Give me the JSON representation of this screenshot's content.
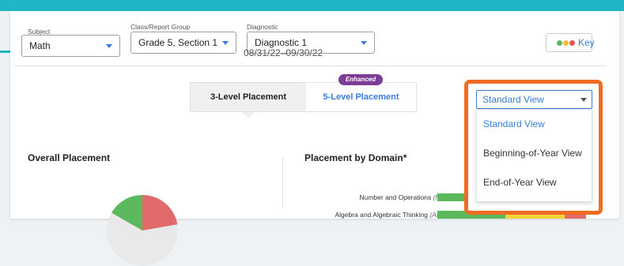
{
  "filters": {
    "subject": {
      "label": "Subject",
      "value": "Math"
    },
    "group": {
      "label": "Class/Report Group",
      "value": "Grade 5, Section 1"
    },
    "diagnostic": {
      "label": "Diagnostic",
      "value": "Diagnostic 1",
      "dates": "08/31/22–09/30/22"
    }
  },
  "key_button": {
    "label": "Key",
    "dot_colors": [
      "#5cb85c",
      "#f2c12e",
      "#e25555"
    ]
  },
  "placement_tabs": {
    "three_level": "3-Level Placement",
    "five_level": "5-Level Placement",
    "badge": "Enhanced"
  },
  "view_select": {
    "value": "Standard View",
    "options": [
      "Standard View",
      "Beginning-of-Year View",
      "End-of-Year View"
    ]
  },
  "overall_title": "Overall Placement",
  "domain_title": "Placement by Domain*",
  "domains": [
    {
      "name": "Number and Operations",
      "abbr": "(NO)"
    },
    {
      "name": "Algebra and Algebraic Thinking",
      "abbr": "(ALG)"
    }
  ],
  "colors": {
    "accent": "#1fb7c7",
    "link": "#3b7dd8",
    "highlight": "#f26b22",
    "badge": "#7d3c98",
    "green": "#5cb85c",
    "yellow": "#f2d43a",
    "red": "#e26a6a"
  }
}
